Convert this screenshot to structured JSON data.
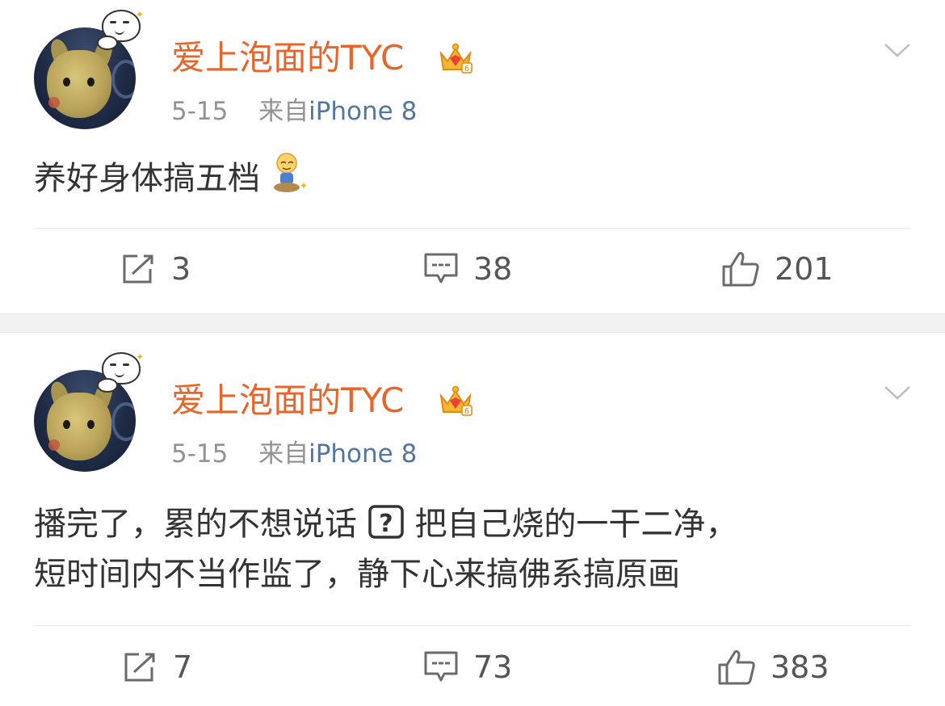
{
  "posts": [
    {
      "username": "爱上泡面的TYC",
      "date": "5-15",
      "source_prefix": "来自",
      "source": "iPhone 8",
      "content_lines": [
        "养好身体搞五档"
      ],
      "emoji_icon": "meditating-person-emoji-icon",
      "actions": {
        "repost": "3",
        "comment": "38",
        "like": "201"
      }
    },
    {
      "username": "爱上泡面的TYC",
      "date": "5-15",
      "source_prefix": "来自",
      "source": "iPhone 8",
      "content_line1_a": "播完了，累的不想说话",
      "content_line1_b": "把自己烧的一干二净，",
      "content_line2": "短时间内不当作监了，静下心来搞佛系搞原画",
      "question_icon": "question-box-icon",
      "actions": {
        "repost": "7",
        "comment": "73",
        "like": "383"
      }
    }
  ],
  "colors": {
    "username": "#e8652a",
    "source_link": "#5276a3",
    "meta": "#939393",
    "body_text": "#333333",
    "divider": "#e8e8e8",
    "separator_band": "#f2f2f2"
  }
}
